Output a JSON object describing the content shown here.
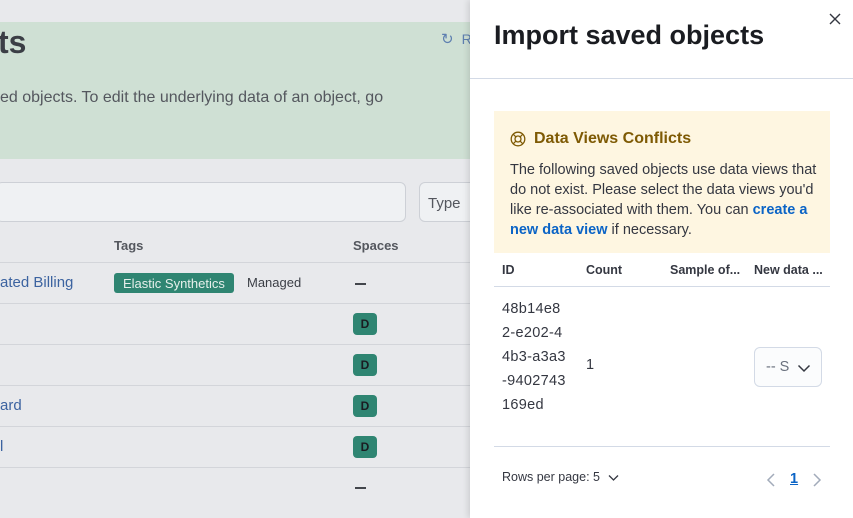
{
  "background": {
    "title": "ts",
    "refresh_label": "R",
    "description": "ed objects. To edit the underlying data of an object, go",
    "type_filter_label": "Type",
    "columns": {
      "tags": "Tags",
      "spaces": "Spaces"
    },
    "rows": [
      {
        "title": "ated Billing",
        "tag": "Elastic Synthetics",
        "tag2": "Managed",
        "space": ""
      },
      {
        "title": "",
        "tag": "",
        "tag2": "",
        "space": "D"
      },
      {
        "title": "",
        "tag": "",
        "tag2": "",
        "space": "D"
      },
      {
        "title": "ard",
        "tag": "",
        "tag2": "",
        "space": "D"
      },
      {
        "title": "l",
        "tag": "",
        "tag2": "",
        "space": "D"
      },
      {
        "title": "",
        "tag": "",
        "tag2": "",
        "space": ""
      }
    ]
  },
  "flyout": {
    "title": "Import saved objects",
    "callout": {
      "title": "Data Views Conflicts",
      "body_prefix": "The following saved objects use data views that do not exist. Please select the data views you'd like re-associated with them. You can ",
      "link_text": "create a new data view",
      "body_suffix": " if necessary."
    },
    "table": {
      "columns": [
        "ID",
        "Count",
        "Sample of...",
        "New data ..."
      ],
      "rows": [
        {
          "id": "48b14e82-e202-44b3-a3a3-9402743169ed",
          "count": "1",
          "new_data_view": "-- Select --"
        }
      ]
    },
    "pagination": {
      "rows_per_page_label": "Rows per page: 5",
      "current_page": "1"
    }
  },
  "colors": {
    "tag_green": "#2f8572",
    "callout_bg": "#fef6e1",
    "callout_title": "#7e5a04",
    "link": "#0b64c6"
  }
}
